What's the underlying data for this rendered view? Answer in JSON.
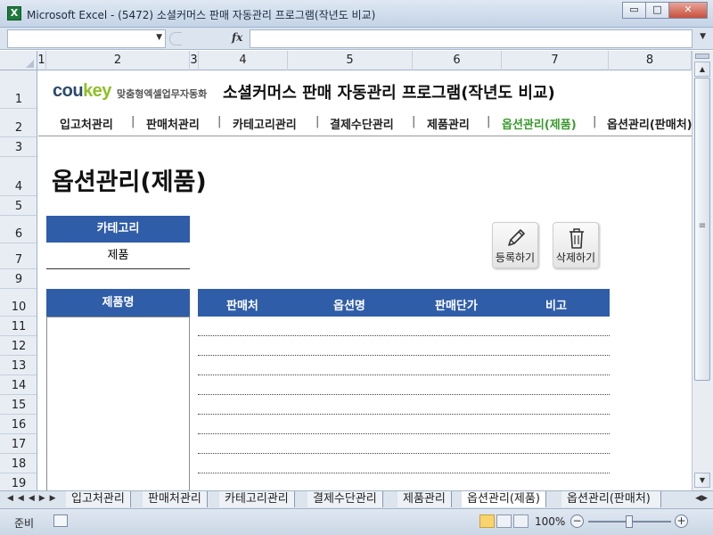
{
  "window": {
    "title": "Microsoft Excel - (5472) 소셜커머스 판매 자동관리 프로그램(작년도 비교)",
    "min": "▭",
    "max": "□",
    "close": "✕"
  },
  "formula_bar": {
    "fx": "fx",
    "namebox_value": "",
    "formula_value": ""
  },
  "columns": [
    "1",
    "2",
    "3",
    "4",
    "5",
    "6",
    "7",
    "8"
  ],
  "rows": [
    "1",
    "2",
    "3",
    "4",
    "5",
    "6",
    "7",
    "9",
    "10",
    "11",
    "12",
    "13",
    "14",
    "15",
    "16",
    "17",
    "18",
    "19"
  ],
  "header": {
    "brand_co": "cou",
    "brand_key": "key",
    "brand_tagline": "맞춤형엑셀업무자동화",
    "app_title": "소셜커머스 판매 자동관리 프로그램(작년도 비교)"
  },
  "nav": {
    "items": [
      "입고처관리",
      "판매처관리",
      "카테고리관리",
      "결제수단관리",
      "제품관리",
      "옵션관리(제품)",
      "옵션관리(판매처)"
    ],
    "separator": "|"
  },
  "page_title": "옵션관리(제품)",
  "category": {
    "label": "카테고리",
    "value": "제품"
  },
  "actions": {
    "register": "등록하기",
    "delete": "삭제하기"
  },
  "product_list": {
    "header": "제품명"
  },
  "grid": {
    "headers": [
      "판매처",
      "옵션명",
      "판매단가",
      "비고"
    ]
  },
  "sheet_tabs": [
    "입고처관리",
    "판매처관리",
    "카테고리관리",
    "결제수단관리",
    "제품관리",
    "옵션관리(제품)",
    "옵션관리(판매처)"
  ],
  "status": {
    "ready": "준비",
    "zoom": "100%"
  },
  "colors": {
    "accent_blue": "#2f5da8",
    "nav_active_green": "#3a9a2e",
    "brand_navy": "#2c4a6e",
    "brand_green": "#8fbf26"
  }
}
